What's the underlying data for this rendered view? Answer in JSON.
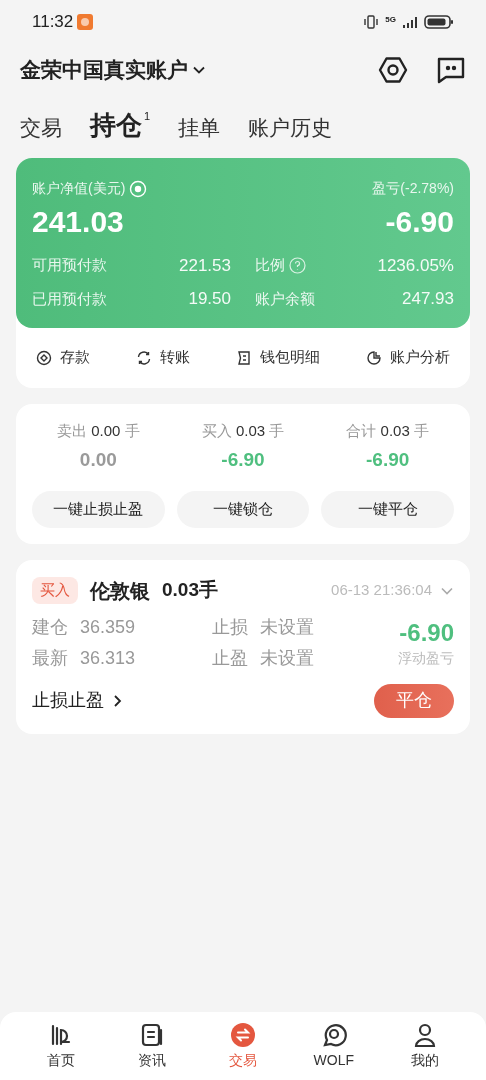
{
  "status_bar": {
    "time": "11:32",
    "network": "5G"
  },
  "header": {
    "account": "金荣中国真实账户"
  },
  "tabs": [
    {
      "label": "交易",
      "selected": false
    },
    {
      "label": "持仓",
      "selected": true,
      "badge": "1"
    },
    {
      "label": "挂单",
      "selected": false
    },
    {
      "label": "账户历史",
      "selected": false
    }
  ],
  "account_card": {
    "equity_label": "账户净值(美元)",
    "equity": "241.03",
    "pnl_label": "盈亏(-2.78%)",
    "pnl": "-6.90",
    "stats": [
      {
        "label": "可用预付款",
        "value": "221.53",
        "info": false
      },
      {
        "label": "比例",
        "value": "1236.05%",
        "info": true
      },
      {
        "label": "已用预付款",
        "value": "19.50",
        "info": false
      },
      {
        "label": "账户余额",
        "value": "247.93",
        "info": false
      }
    ],
    "actions": [
      {
        "label": "存款",
        "kind": "deposit"
      },
      {
        "label": "转账",
        "kind": "transfer"
      },
      {
        "label": "钱包明细",
        "kind": "wallet"
      },
      {
        "label": "账户分析",
        "kind": "analysis"
      }
    ]
  },
  "totals": [
    {
      "label": "卖出",
      "lots": "0.00",
      "unit": "手",
      "pnl": "0.00",
      "color": "#9a9a9a"
    },
    {
      "label": "买入",
      "lots": "0.03",
      "unit": "手",
      "pnl": "-6.90",
      "color": "#4fbf7f"
    },
    {
      "label": "合计",
      "lots": "0.03",
      "unit": "手",
      "pnl": "-6.90",
      "color": "#4fbf7f"
    }
  ],
  "bulk_buttons": [
    "一键止损止盈",
    "一键锁仓",
    "一键平仓"
  ],
  "position": {
    "side": "买入",
    "symbol": "伦敦银",
    "lots": "0.03手",
    "time": "06-13 21:36:04",
    "expanded": false,
    "fields": [
      {
        "label": "建仓",
        "value": "36.359"
      },
      {
        "label": "止损",
        "value": "未设置"
      },
      {
        "label": "最新",
        "value": "36.313"
      },
      {
        "label": "止盈",
        "value": "未设置"
      }
    ],
    "pnl": "-6.90",
    "pnl_label": "浮动盈亏",
    "sl_tp_link": "止损止盈",
    "close_button": "平仓"
  },
  "nav": [
    {
      "label": "首页",
      "kind": "home",
      "selected": false
    },
    {
      "label": "资讯",
      "kind": "news",
      "selected": false
    },
    {
      "label": "交易",
      "kind": "trade",
      "selected": true
    },
    {
      "label": "WOLF",
      "kind": "wolf",
      "selected": false
    },
    {
      "label": "我的",
      "kind": "me",
      "selected": false
    }
  ]
}
